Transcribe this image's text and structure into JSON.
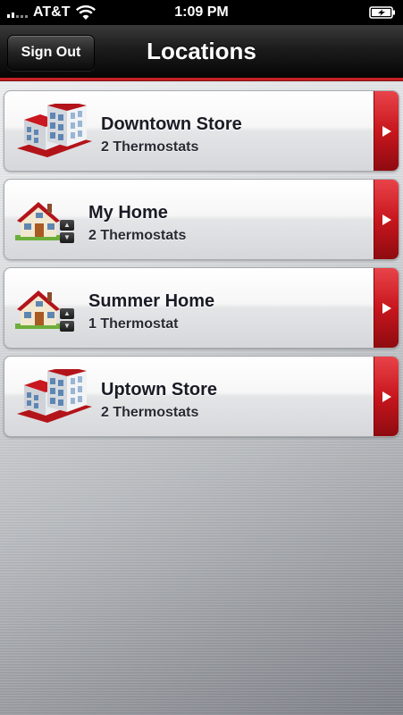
{
  "status_bar": {
    "carrier": "AT&T",
    "time": "1:09 PM"
  },
  "nav_bar": {
    "title": "Locations",
    "sign_out_label": "Sign Out"
  },
  "locations": [
    {
      "name": "Downtown Store",
      "thermostats": "2 Thermostats",
      "icon": "store-building-icon"
    },
    {
      "name": "My Home",
      "thermostats": "2 Thermostats",
      "icon": "house-icon"
    },
    {
      "name": "Summer Home",
      "thermostats": "1 Thermostat",
      "icon": "house-icon"
    },
    {
      "name": "Uptown Store",
      "thermostats": "2 Thermostats",
      "icon": "store-building-icon"
    }
  ],
  "colors": {
    "accent_red": "#c8161d",
    "nav_black": "#050505"
  }
}
